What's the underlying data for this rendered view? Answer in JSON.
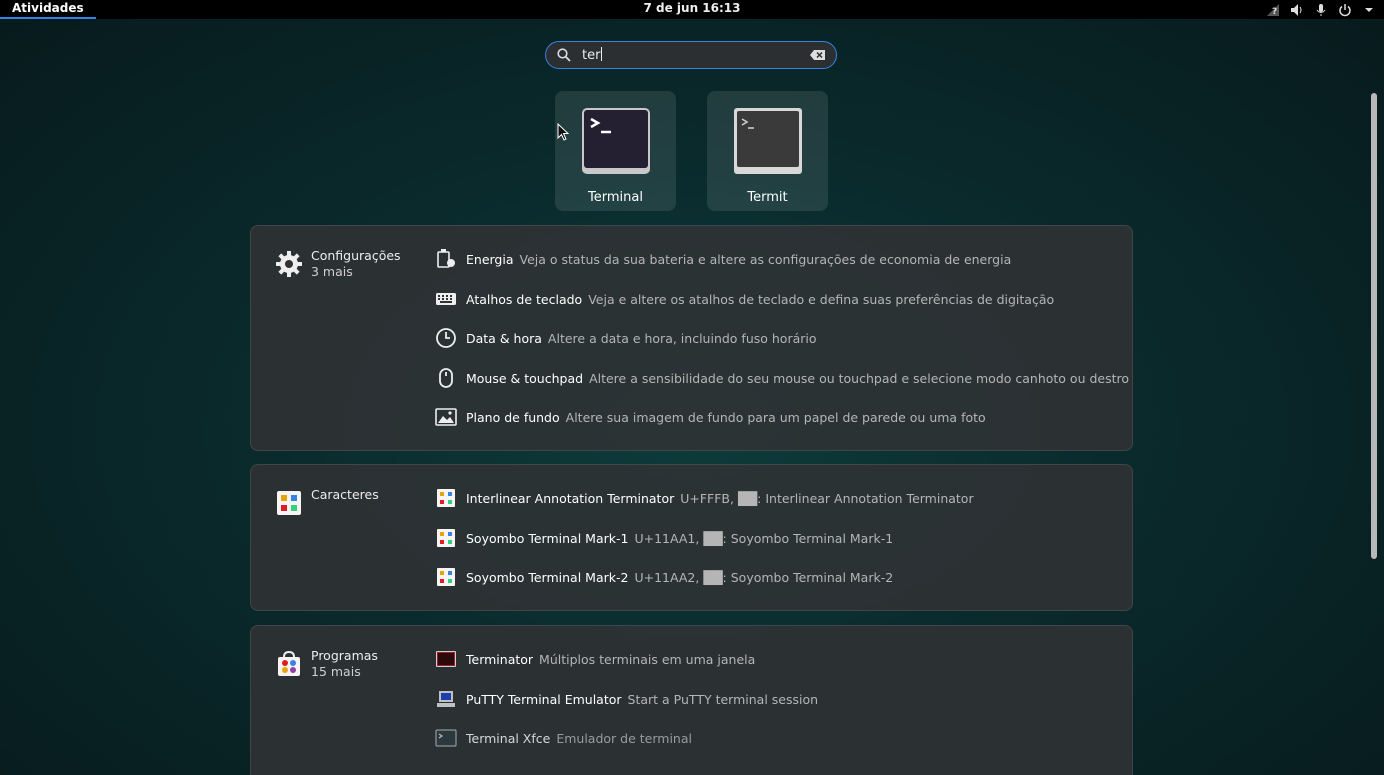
{
  "topbar": {
    "activities": "Atividades",
    "clock": "7 de jun  16:13",
    "tray_icons": [
      "network-unknown-icon",
      "volume-icon",
      "microphone-icon",
      "power-icon",
      "chevron-down-icon"
    ]
  },
  "search": {
    "value": "ter"
  },
  "apps": [
    {
      "label": "Terminal",
      "icon": "terminal-icon"
    },
    {
      "label": "Termit",
      "icon": "termit-icon"
    }
  ],
  "providers": [
    {
      "name": "Configurações",
      "more": "3 mais",
      "icon": "gear-icon",
      "results": [
        {
          "title": "Energia",
          "desc": "Veja o status da sua bateria e altere as configurações de economia de energia",
          "icon": "power-settings-icon"
        },
        {
          "title": "Atalhos de teclado",
          "desc": "Veja e altere os atalhos de teclado e defina suas preferências de digitação",
          "icon": "keyboard-icon"
        },
        {
          "title": "Data & hora",
          "desc": "Altere a data e hora, incluindo fuso horário",
          "icon": "clock-icon"
        },
        {
          "title": "Mouse & touchpad",
          "desc": "Altere a sensibilidade do seu mouse ou touchpad e selecione modo canhoto ou destro",
          "icon": "mouse-icon"
        },
        {
          "title": "Plano de fundo",
          "desc": "Altere sua imagem de fundo para um papel de parede ou uma foto",
          "icon": "wallpaper-icon"
        }
      ]
    },
    {
      "name": "Caracteres",
      "more": "",
      "icon": "characters-app-icon",
      "results": [
        {
          "title": "Interlinear Annotation Terminator",
          "desc": "U+FFFB, ██: Interlinear Annotation Terminator",
          "icon": "characters-app-icon"
        },
        {
          "title": "Soyombo Terminal Mark-1",
          "desc": "U+11AA1, ██: Soyombo Terminal Mark-1",
          "icon": "characters-app-icon"
        },
        {
          "title": "Soyombo Terminal Mark-2",
          "desc": "U+11AA2, ██: Soyombo Terminal Mark-2",
          "icon": "characters-app-icon"
        }
      ]
    },
    {
      "name": "Programas",
      "more": "15 mais",
      "icon": "software-app-icon",
      "results": [
        {
          "title": "Terminator",
          "desc": "Múltiplos terminais em uma janela",
          "icon": "terminator-icon"
        },
        {
          "title": "PuTTY Terminal Emulator",
          "desc": "Start a PuTTY terminal session",
          "icon": "putty-icon"
        },
        {
          "title": "Terminal Xfce",
          "desc": "Emulador de terminal",
          "icon": "xfce-terminal-icon"
        }
      ]
    }
  ],
  "colors": {
    "accent": "#3584e4",
    "panel_bg": "#303234"
  }
}
